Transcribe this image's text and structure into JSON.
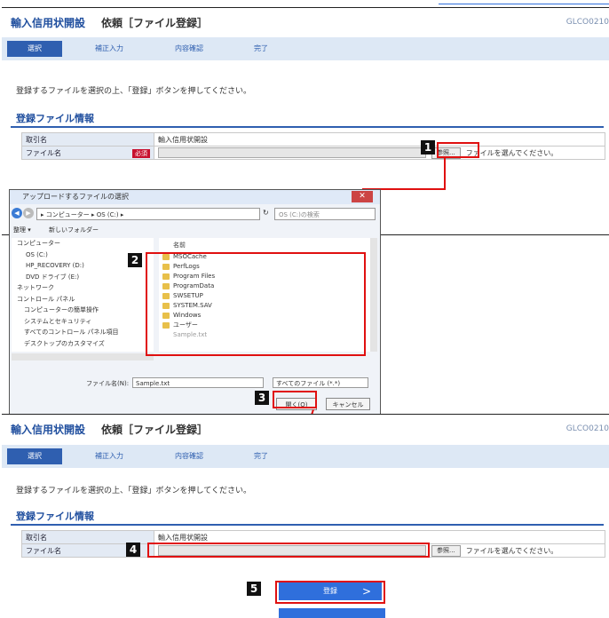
{
  "screen1": {
    "title": "輸入信用状開設",
    "subtitle": "依頼［ファイル登録］",
    "code": "GLCO0210",
    "steps": [
      "選択",
      "補正入力",
      "内容確認",
      "完了"
    ],
    "instruction": "登録するファイルを選択の上、「登録」ボタンを押してください。",
    "section_title": "登録ファイル情報",
    "row1_label": "取引名",
    "row1_value": "輸入信用状開設",
    "row2_label": "ファイル名",
    "required": "必須",
    "browse": "参照...",
    "hint": "ファイルを選んでください。",
    "register": "登録"
  },
  "dialog": {
    "title": "アップロードするファイルの選択",
    "close": "✕",
    "address": "▸ コンピューター ▸ OS (C:) ▸",
    "search_placeholder": "OS (C:)の検索",
    "organize": "整理 ▾",
    "new_folder": "新しいフォルダー",
    "column_name": "名前",
    "tree": [
      "コンピューター",
      "OS (C:)",
      "HP_RECOVERY (D:)",
      "DVD ドライブ (E:)",
      "ネットワーク",
      "コントロール パネル",
      "コンピューターの簡単操作",
      "システムとセキュリティ",
      "すべてのコントロール パネル項目",
      "デスクトップのカスタマイズ"
    ],
    "files": [
      "MSOCache",
      "PerfLogs",
      "Program Files",
      "ProgramData",
      "SWSETUP",
      "SYSTEM.SAV",
      "Windows",
      "ユーザー",
      "Sample.txt"
    ],
    "filename_label": "ファイル名(N):",
    "filename_value": "Sample.txt",
    "filetype": "すべてのファイル (*.*)",
    "open": "開く(O)",
    "cancel": "キャンセル"
  },
  "screen2": {
    "title": "輸入信用状開設",
    "subtitle": "依頼［ファイル登録］",
    "code": "GLCO0210",
    "steps": [
      "選択",
      "補正入力",
      "内容確認",
      "完了"
    ],
    "instruction": "登録するファイルを選択の上、「登録」ボタンを押してください。",
    "section_title": "登録ファイル情報",
    "row1_label": "取引名",
    "row1_value": "輸入信用状開設",
    "row2_label": "ファイル名",
    "browse": "参照...",
    "hint": "ファイルを選んでください。",
    "register": "登録"
  },
  "badges": [
    "1",
    "2",
    "3",
    "4",
    "5"
  ]
}
